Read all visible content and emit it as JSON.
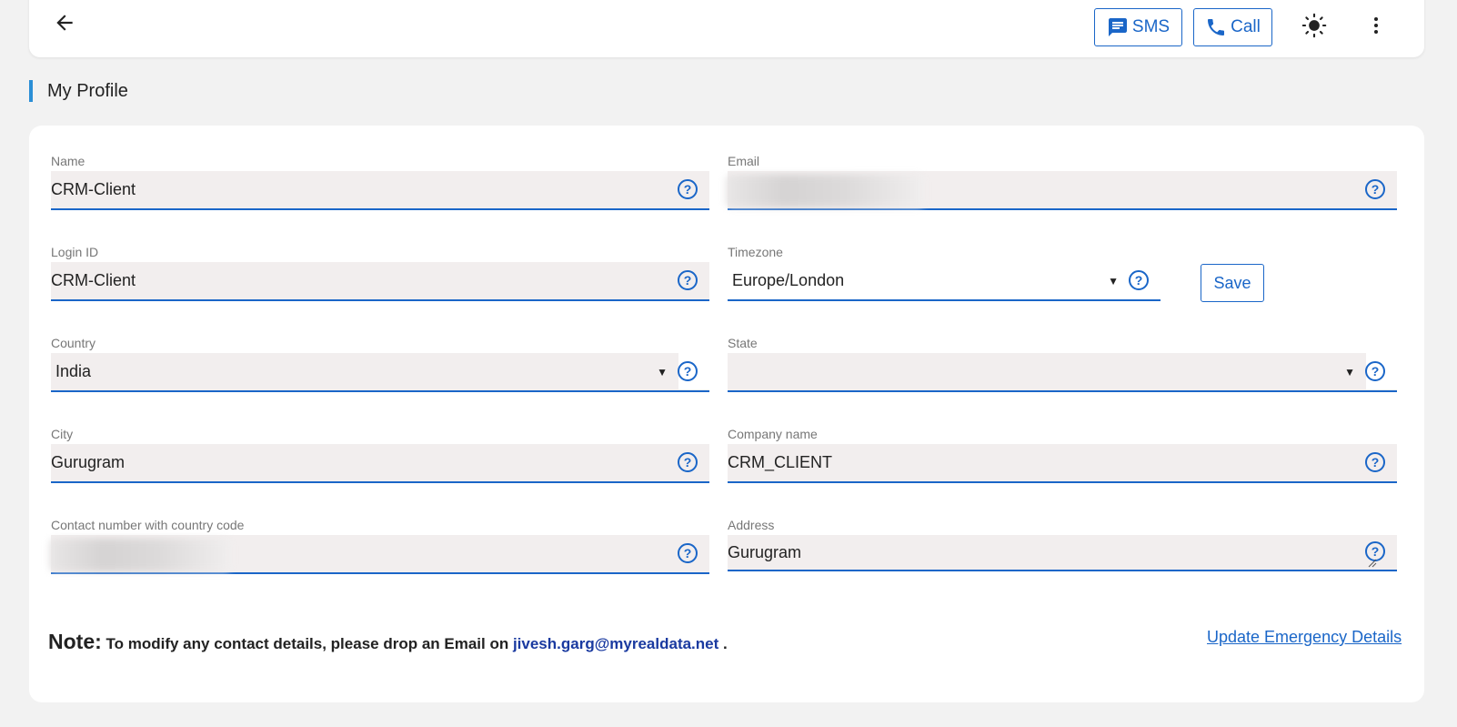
{
  "header": {
    "sms_label": "SMS",
    "call_label": "Call"
  },
  "page_title": "My Profile",
  "form": {
    "name": {
      "label": "Name",
      "value": "CRM-Client"
    },
    "email": {
      "label": "Email",
      "value": ""
    },
    "login_id": {
      "label": "Login ID",
      "value": "CRM-Client"
    },
    "timezone": {
      "label": "Timezone",
      "value": "Europe/London"
    },
    "save_label": "Save",
    "country": {
      "label": "Country",
      "value": "India"
    },
    "state": {
      "label": "State",
      "value": ""
    },
    "city": {
      "label": "City",
      "value": "Gurugram"
    },
    "company_name": {
      "label": "Company name",
      "value": "CRM_CLIENT"
    },
    "contact_number": {
      "label": "Contact number with country code",
      "value": ""
    },
    "address": {
      "label": "Address",
      "value": "Gurugram"
    }
  },
  "note": {
    "title": "Note:",
    "text": " To modify any contact details, please drop an Email on ",
    "email": "jivesh.garg@myrealdata.net",
    "suffix": " ."
  },
  "emergency_link": "Update Emergency Details",
  "colors": {
    "accent": "#1a66c8",
    "section_bar": "#2b8fd6",
    "field_bg": "#f2eeee",
    "page_bg": "#f2f2f2"
  },
  "icons": [
    "back-arrow-icon",
    "message-icon",
    "phone-icon",
    "brightness-icon",
    "more-vert-icon",
    "help-circle-icon"
  ]
}
